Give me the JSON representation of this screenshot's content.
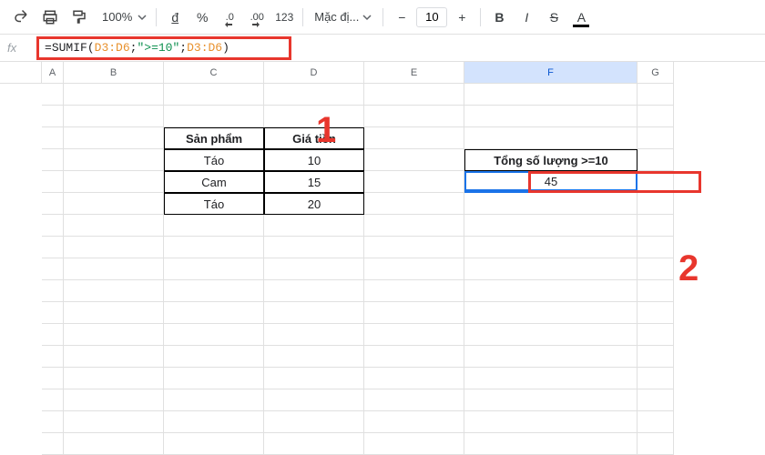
{
  "toolbar": {
    "zoom": "100%",
    "font_label": "Mặc đị...",
    "font_size": "10",
    "currency_symbol": "đ",
    "percent": "%",
    "dec_dec": ".0",
    "dec_inc": ".00",
    "num_fmt": "123",
    "bold": "B",
    "italic": "I",
    "strike": "S",
    "textcolor": "A",
    "minus": "−",
    "plus": "+"
  },
  "formula": {
    "fx": "fx",
    "eq": "=",
    "func": "SUMIF",
    "open": "(",
    "r1": "D3:D6",
    "sep1": "; ",
    "crit": "\">=10\"",
    "sep2": "; ",
    "r2": "D3:D6",
    "close": ")"
  },
  "columns": {
    "A": "A",
    "B": "B",
    "C": "C",
    "D": "D",
    "E": "E",
    "F": "F",
    "G": "G"
  },
  "annotations": {
    "one": "1",
    "two": "2"
  },
  "table": {
    "h1": "Sản phẩm",
    "h2": "Giá tiền",
    "r1c1": "Táo",
    "r1c2": "10",
    "r2c1": "Cam",
    "r2c2": "15",
    "r3c1": "Táo",
    "r3c2": "20"
  },
  "result": {
    "header": "Tổng số lượng >=10",
    "value": "45"
  }
}
